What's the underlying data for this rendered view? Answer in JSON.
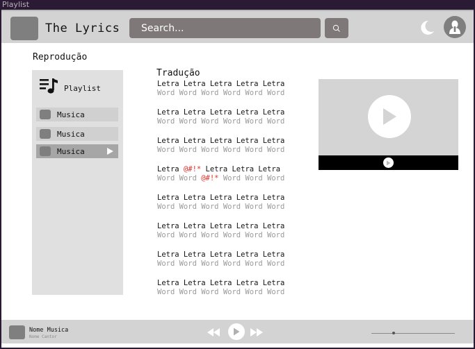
{
  "window": {
    "title": "Playlist"
  },
  "header": {
    "app_title": "The Lyrics",
    "search_placeholder": "Search...",
    "search_icon": "magnifier-icon",
    "theme_icon": "moon-icon",
    "avatar_icon": "user-icon"
  },
  "section_title": "Reprodução",
  "sidebar": {
    "playlist_label": "Playlist",
    "playlist_icon": "playlist-music-icon",
    "tracks": [
      {
        "label": "Musica",
        "active": false
      },
      {
        "label": "Musica",
        "active": false
      },
      {
        "label": "Musica",
        "active": true
      }
    ]
  },
  "lyrics": {
    "title": "Tradução",
    "stanzas": [
      {
        "original": "Letra Letra Letra Letra Letra",
        "translation": "Word Word Word Word Word Word"
      },
      {
        "original": "Letra Letra Letra Letra Letra",
        "translation": "Word Word Word Word Word Word"
      },
      {
        "original": "Letra Letra Letra Letra Letra",
        "translation": "Word Word Word Word Word Word"
      },
      {
        "original": [
          "Letra ",
          "@#!*",
          " Letra Letra Letra"
        ],
        "translation": [
          "Word Word ",
          "@#!*",
          " Word Word Word"
        ]
      },
      {
        "original": "Letra Letra Letra Letra Letra",
        "translation": "Word Word Word Word Word Word"
      },
      {
        "original": "Letra Letra Letra Letra Letra",
        "translation": "Word Word Word Word Word Word"
      },
      {
        "original": "Letra Letra Letra Letra Letra",
        "translation": "Word Word Word Word Word Word"
      },
      {
        "original": "Letra Letra Letra Letra Letra",
        "translation": "Word Word Word Word Word Word"
      }
    ]
  },
  "video": {
    "play_icon": "play-icon"
  },
  "player": {
    "song_name": "Nome Musica",
    "artist_name": "Nome Cantor",
    "prev_icon": "rewind-icon",
    "play_icon": "play-icon",
    "next_icon": "fast-forward-icon",
    "progress": 0.27
  },
  "colors": {
    "accent_dark": "#2a1a33",
    "censor": "#e0322b",
    "panel_gray": "#d3d3d3"
  }
}
